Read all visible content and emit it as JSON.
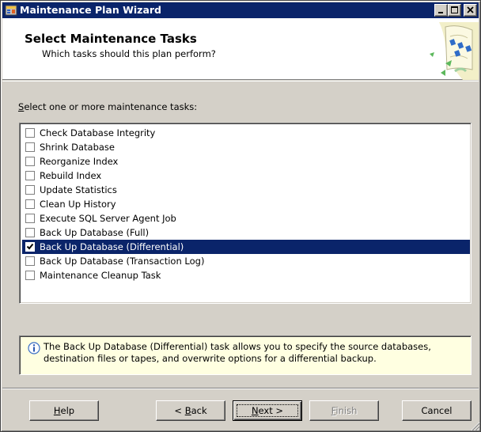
{
  "window": {
    "title": "Maintenance Plan Wizard",
    "icon": "wizard-app-icon"
  },
  "header": {
    "title": "Select Maintenance Tasks",
    "subtitle": "Which tasks should this plan perform?",
    "graphic": "wizard-banner-graphic"
  },
  "tasks": {
    "label_prefix": "S",
    "label_rest": "elect one or more maintenance tasks:",
    "items": [
      {
        "label": "Check Database Integrity",
        "checked": false,
        "selected": false
      },
      {
        "label": "Shrink Database",
        "checked": false,
        "selected": false
      },
      {
        "label": "Reorganize Index",
        "checked": false,
        "selected": false
      },
      {
        "label": "Rebuild Index",
        "checked": false,
        "selected": false
      },
      {
        "label": "Update Statistics",
        "checked": false,
        "selected": false
      },
      {
        "label": "Clean Up History",
        "checked": false,
        "selected": false
      },
      {
        "label": "Execute SQL Server Agent Job",
        "checked": false,
        "selected": false
      },
      {
        "label": "Back Up Database (Full)",
        "checked": false,
        "selected": false
      },
      {
        "label": "Back Up Database (Differential)",
        "checked": true,
        "selected": true
      },
      {
        "label": "Back Up Database (Transaction Log)",
        "checked": false,
        "selected": false
      },
      {
        "label": "Maintenance Cleanup Task",
        "checked": false,
        "selected": false
      }
    ]
  },
  "info": {
    "icon": "info-icon",
    "text": "The Back Up Database (Differential) task allows you to specify the source databases, destination files or tapes, and overwrite options for a differential backup."
  },
  "buttons": {
    "help": {
      "mnemonic": "H",
      "rest": "elp",
      "enabled": true
    },
    "back_prefix": "< ",
    "back": {
      "mnemonic": "B",
      "rest": "ack",
      "enabled": true
    },
    "next": {
      "mnemonic": "N",
      "rest": "ext",
      "suffix": " >",
      "enabled": true
    },
    "finish": {
      "mnemonic": "F",
      "rest": "inish",
      "enabled": false
    },
    "cancel": {
      "label": "Cancel",
      "enabled": true
    }
  },
  "colors": {
    "titlebar": "#0a246a",
    "selection": "#0a246a",
    "face": "#d4d0c8",
    "info_background": "#ffffe1"
  }
}
